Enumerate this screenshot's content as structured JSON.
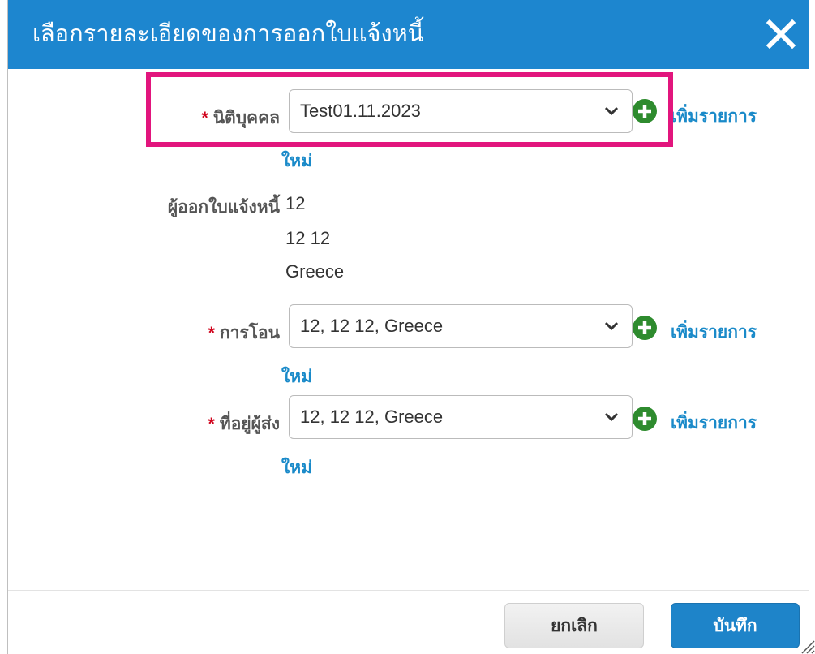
{
  "dialog": {
    "title": "เลือกรายละเอียดของการออกใบแจ้งหนี้",
    "close_icon": "close-icon"
  },
  "form": {
    "required_mark": "*",
    "legal_entity": {
      "label": "นิติบุคคล",
      "value": "Test01.11.2023",
      "add_link": "เพิ่มรายการ",
      "new_link": "ใหม่"
    },
    "invoicer": {
      "label": "ผู้ออกใบแจ้งหนี้",
      "lines": [
        "12",
        "12 12",
        "Greece"
      ]
    },
    "remit_to": {
      "label": "การโอน",
      "value": "12, 12 12, Greece",
      "add_link": "เพิ่มรายการ",
      "new_link": "ใหม่"
    },
    "ship_from": {
      "label": "ที่อยู่ผู้ส่ง",
      "value": "12, 12 12, Greece",
      "add_link": "เพิ่มรายการ",
      "new_link": "ใหม่"
    }
  },
  "footer": {
    "cancel_label": "ยกเลิก",
    "save_label": "บันทึก"
  },
  "colors": {
    "header_bg": "#1d86cf",
    "link": "#1a8ac9",
    "add_icon": "#2e8b2e",
    "required": "#d0021b",
    "highlight": "#e2157d",
    "primary_button": "#1e84c9"
  }
}
